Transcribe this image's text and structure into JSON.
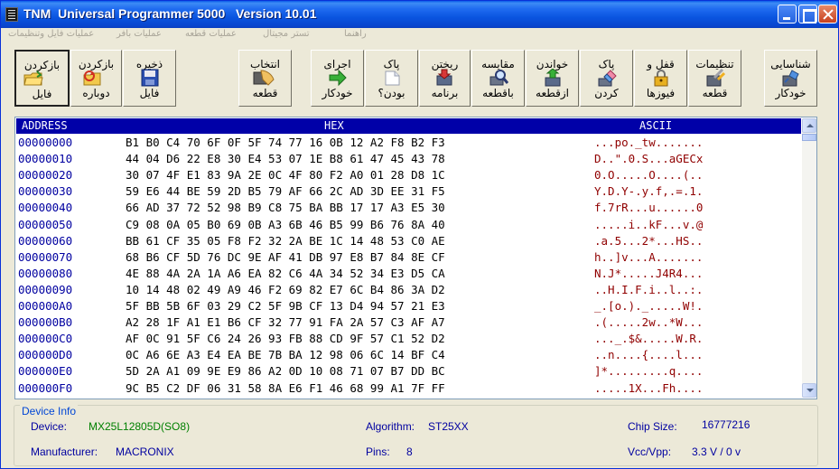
{
  "window": {
    "title": "TNM  Universal Programmer 5000   Version 10.01"
  },
  "menu": [
    "عملیات فایل وتنظیمات",
    "عملیات بافر",
    "عملیات قطعه",
    "تستر مجیتال",
    "راهنما"
  ],
  "toolbar": {
    "buttons": [
      {
        "id": "reload-file",
        "line1": "بازکردن",
        "line2": "فایل",
        "icon": "folder-open-icon"
      },
      {
        "id": "reopen",
        "line1": "بازکردن",
        "line2": "دوباره",
        "icon": "reopen-icon"
      },
      {
        "id": "save-file",
        "line1": "ذخیره",
        "line2": "فایل",
        "icon": "floppy-disk-icon"
      },
      {
        "id": "select-chip",
        "line1": "انتخاب",
        "line2": "قطعه",
        "icon": "select-chip-icon"
      },
      {
        "id": "auto-run",
        "line1": "اجرای",
        "line2": "خودکار",
        "icon": "auto-run-icon"
      },
      {
        "id": "blank-check",
        "line1": "پاک",
        "line2": "بودن؟",
        "icon": "blank-check-icon"
      },
      {
        "id": "program",
        "line1": "ریختن",
        "line2": "برنامه",
        "icon": "program-icon"
      },
      {
        "id": "compare",
        "line1": "مقایسه",
        "line2": "باقطعه",
        "icon": "compare-icon"
      },
      {
        "id": "read",
        "line1": "خواندن",
        "line2": "ازقطعه",
        "icon": "read-icon"
      },
      {
        "id": "erase",
        "line1": "پاک",
        "line2": "کردن",
        "icon": "erase-icon"
      },
      {
        "id": "lock-fuses",
        "line1": "قفل و",
        "line2": "فیوزها",
        "icon": "lock-icon"
      },
      {
        "id": "chip-settings",
        "line1": "تنظیمات",
        "line2": "قطعه",
        "icon": "settings-icon"
      },
      {
        "id": "auto-detect",
        "line1": "شناسایی",
        "line2": "خودکار",
        "icon": "auto-detect-icon"
      }
    ]
  },
  "hex": {
    "headers": {
      "address": "ADDRESS",
      "hex": "HEX",
      "ascii": "ASCII"
    },
    "rows": [
      {
        "addr": "00000000",
        "bytes": "B1 B0 C4 70 6F 0F 5F 74 77 16 0B 12 A2 F8 B2 F3",
        "ascii": "...po._tw......."
      },
      {
        "addr": "00000010",
        "bytes": "44 04 D6 22 E8 30 E4 53 07 1E B8 61 47 45 43 78",
        "ascii": "D..\".0.S...aGECx"
      },
      {
        "addr": "00000020",
        "bytes": "30 07 4F E1 83 9A 2E 0C 4F 80 F2 A0 01 28 D8 1C",
        "ascii": "0.O.....O....(.."
      },
      {
        "addr": "00000030",
        "bytes": "59 E6 44 BE 59 2D B5 79 AF 66 2C AD 3D EE 31 F5",
        "ascii": "Y.D.Y-.y.f,.=.1."
      },
      {
        "addr": "00000040",
        "bytes": "66 AD 37 72 52 98 B9 C8 75 BA BB 17 17 A3 E5 30",
        "ascii": "f.7rR...u......0"
      },
      {
        "addr": "00000050",
        "bytes": "C9 08 0A 05 B0 69 0B A3 6B 46 B5 99 B6 76 8A 40",
        "ascii": ".....i..kF...v.@"
      },
      {
        "addr": "00000060",
        "bytes": "BB 61 CF 35 05 F8 F2 32 2A BE 1C 14 48 53 C0 AE",
        "ascii": ".a.5...2*...HS.."
      },
      {
        "addr": "00000070",
        "bytes": "68 B6 CF 5D 76 DC 9E AF 41 DB 97 E8 B7 84 8E CF",
        "ascii": "h..]v...A......."
      },
      {
        "addr": "00000080",
        "bytes": "4E 88 4A 2A 1A A6 EA 82 C6 4A 34 52 34 E3 D5 CA",
        "ascii": "N.J*.....J4R4..."
      },
      {
        "addr": "00000090",
        "bytes": "10 14 48 02 49 A9 46 F2 69 82 E7 6C B4 86 3A D2",
        "ascii": "..H.I.F.i..l..:."
      },
      {
        "addr": "000000A0",
        "bytes": "5F BB 5B 6F 03 29 C2 5F 9B CF 13 D4 94 57 21 E3",
        "ascii": "_.[o.)._.....W!."
      },
      {
        "addr": "000000B0",
        "bytes": "A2 28 1F A1 E1 B6 CF 32 77 91 FA 2A 57 C3 AF A7",
        "ascii": ".(.....2w..*W..."
      },
      {
        "addr": "000000C0",
        "bytes": "AF 0C 91 5F C6 24 26 93 FB 88 CD 9F 57 C1 52 D2",
        "ascii": "..._.$&.....W.R."
      },
      {
        "addr": "000000D0",
        "bytes": "0C A6 6E A3 E4 EA BE 7B BA 12 98 06 6C 14 BF C4",
        "ascii": "..n....{....l..."
      },
      {
        "addr": "000000E0",
        "bytes": "5D 2A A1 09 9E E9 86 A2 0D 10 08 71 07 B7 DD BC",
        "ascii": "]*.........q...."
      },
      {
        "addr": "000000F0",
        "bytes": "9C B5 C2 DF 06 31 58 8A E6 F1 46 68 99 A1 7F FF",
        "ascii": ".....1X...Fh...."
      }
    ]
  },
  "device_info": {
    "legend": "Device Info",
    "device_label": "Device:",
    "device_value": "MX25L12805D(SO8)",
    "manufacturer_label": "Manufacturer:",
    "manufacturer_value": "MACRONIX",
    "algorithm_label": "Algorithm:",
    "algorithm_value": "ST25XX",
    "pins_label": "Pins:",
    "pins_value": "8",
    "chipsize_label": "Chip Size:",
    "chipsize_value": "16777216",
    "vcc_label": "Vcc/Vpp:",
    "vcc_value": "3.3 V / 0 v"
  }
}
